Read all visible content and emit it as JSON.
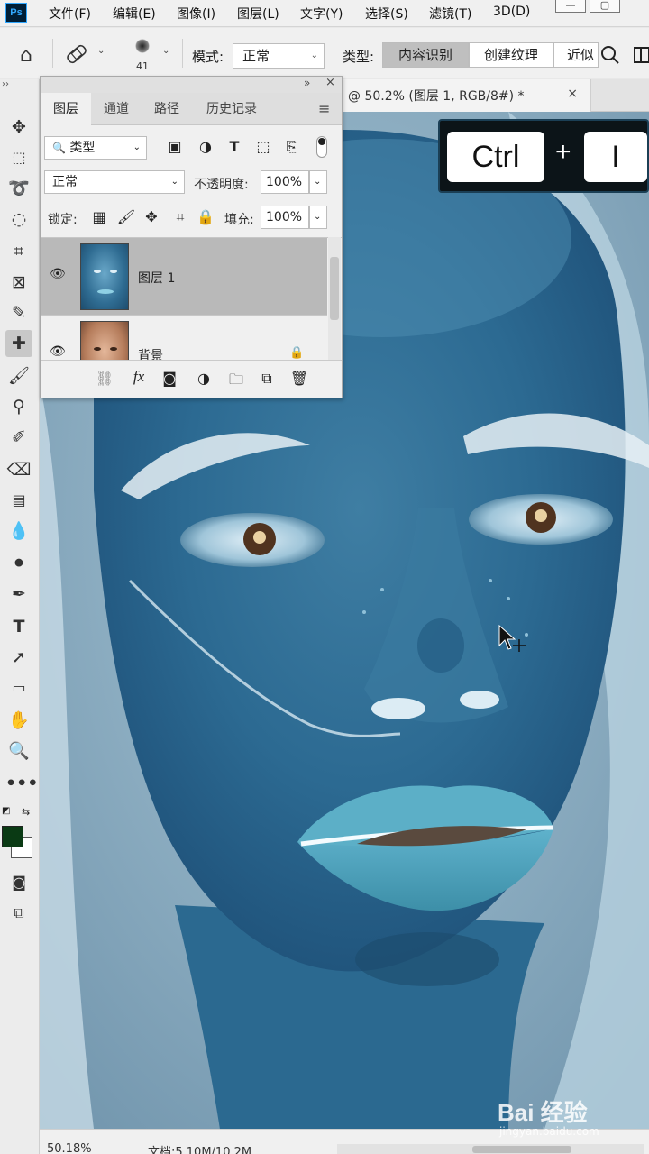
{
  "menubar": {
    "logo": "Ps",
    "items": [
      "文件(F)",
      "编辑(E)",
      "图像(I)",
      "图层(L)",
      "文字(Y)",
      "选择(S)",
      "滤镜(T)",
      "3D(D)"
    ],
    "window_buttons": [
      "—",
      "▢"
    ]
  },
  "options": {
    "brush_size": "41",
    "mode_label": "模式:",
    "mode_value": "正常",
    "type_label": "类型:",
    "type_buttons": [
      "内容识别",
      "创建纹理",
      "近似"
    ],
    "active_type": "内容识别"
  },
  "document": {
    "tab_title": "@ 50.2% (图层 1, RGB/8#) *",
    "close": "×"
  },
  "shortcut": {
    "key1": "Ctrl",
    "plus": "+",
    "key2": "I"
  },
  "layers_panel": {
    "collapse": "»",
    "close": "×",
    "tabs": [
      "图层",
      "通道",
      "路径",
      "历史记录"
    ],
    "active_tab": "图层",
    "filter_label": "类型",
    "blend_mode": "正常",
    "opacity_label": "不透明度:",
    "opacity_value": "100%",
    "lock_label": "锁定:",
    "fill_label": "填充:",
    "fill_value": "100%",
    "layers": [
      {
        "name": "图层 1",
        "selected": true,
        "thumb": "inverted"
      },
      {
        "name": "背景",
        "selected": false,
        "thumb": "original",
        "locked": true
      }
    ],
    "footer_icons": [
      "link-icon",
      "fx-icon",
      "mask-icon",
      "adjustment-icon",
      "group-icon",
      "new-layer-icon",
      "trash-icon"
    ],
    "fx_label": "fx"
  },
  "status": {
    "zoom": "50.18%",
    "doc_info": "文档:5.10M/10.2M"
  },
  "watermark": {
    "brand": "Bai 经验",
    "url": "jingyan.baidu.com"
  },
  "colors": {
    "foreground": "#0a3a14",
    "background": "#ffffff",
    "accent": "#31a8ff"
  }
}
